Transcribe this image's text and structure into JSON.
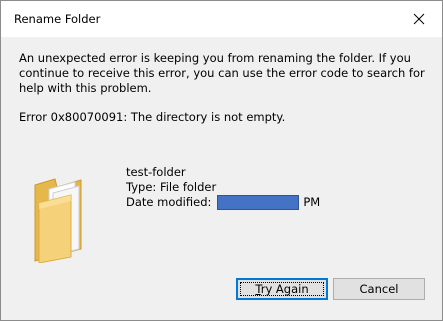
{
  "window": {
    "title": "Rename Folder"
  },
  "message": {
    "text": "An unexpected error is keeping you from renaming the folder. If you continue to receive this error, you can use the error code to search for help with this problem.",
    "error_code": "Error 0x80070091: The directory is not empty."
  },
  "item": {
    "name": "test-folder",
    "type": "Type: File folder",
    "date_label": "Date modified:",
    "date_suffix": "PM"
  },
  "buttons": {
    "try_again_mnemonic": "T",
    "try_again_rest": "ry Again",
    "cancel": "Cancel"
  },
  "icons": {
    "close": "close-icon",
    "folder": "folder-icon"
  },
  "colors": {
    "accent": "#0078d7",
    "redaction": "#4472c4"
  }
}
